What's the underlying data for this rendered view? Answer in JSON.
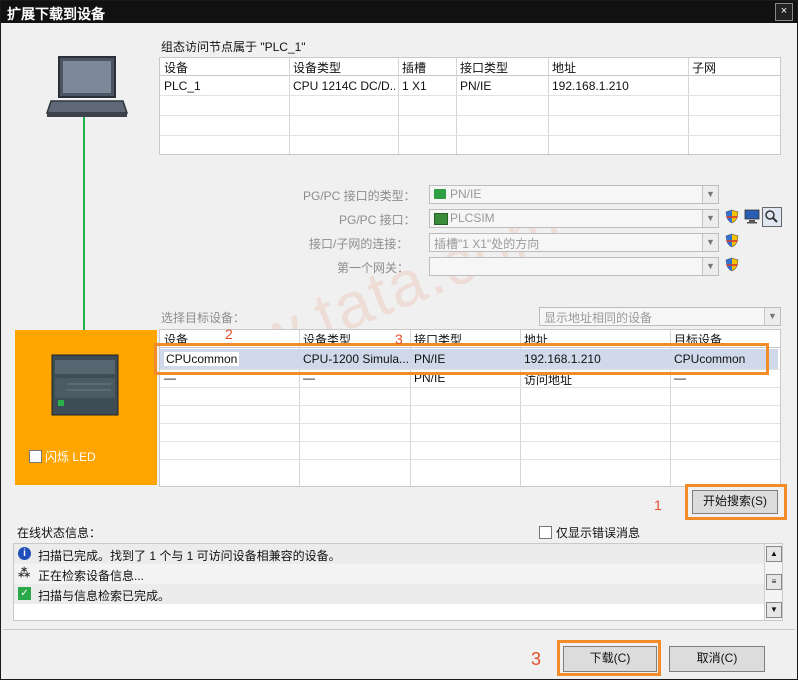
{
  "window": {
    "title": "扩展下载到设备",
    "close_glyph": "×"
  },
  "access_node": {
    "label": "组态访问节点属于 \"PLC_1\"",
    "columns": [
      "设备",
      "设备类型",
      "插槽",
      "接口类型",
      "地址",
      "子网"
    ],
    "row": [
      "PLC_1",
      "CPU 1214C DC/D...",
      "1 X1",
      "PN/IE",
      "192.168.1.210",
      ""
    ]
  },
  "config": {
    "pgpc_type_label": "PG/PC 接口的类型：",
    "pgpc_type_value": "PN/IE",
    "pgpc_if_label": "PG/PC 接口：",
    "pgpc_if_value": "PLCSIM",
    "subnet_label": "接口/子网的连接：",
    "subnet_value": "插槽\"1 X1\"处的方向",
    "gateway_label": "第一个网关：",
    "gateway_value": ""
  },
  "target": {
    "label": "选择目标设备：",
    "filter": "显示地址相同的设备",
    "columns": [
      "设备",
      "设备类型",
      "接口类型",
      "地址",
      "目标设备"
    ],
    "rows": [
      [
        "CPUcommon",
        "CPU-1200 Simula...",
        "PN/IE",
        "192.168.1.210",
        "CPUcommon"
      ],
      [
        "—",
        "—",
        "PN/IE",
        "访问地址",
        "—"
      ]
    ]
  },
  "flash_led_label": "闪烁 LED",
  "search_button": "开始搜索(S)",
  "status": {
    "label": "在线状态信息：",
    "errors_only": "仅显示错误消息",
    "messages": [
      "扫描已完成。找到了 1 个与 1 可访问设备相兼容的设备。",
      "正在检索设备信息...",
      "扫描与信息检索已完成。"
    ]
  },
  "buttons": {
    "download": "下载(C)",
    "cancel": "取消(C)"
  },
  "annotations": {
    "n1": "1",
    "n2": "2",
    "n3a": "3",
    "n3b": "3"
  },
  "watermark": "www.tata.com",
  "colors": {
    "orange": "#ffa500",
    "highlight": "#f28c28",
    "link_green": "#22b14c",
    "row_select": "#cfd9ea"
  }
}
